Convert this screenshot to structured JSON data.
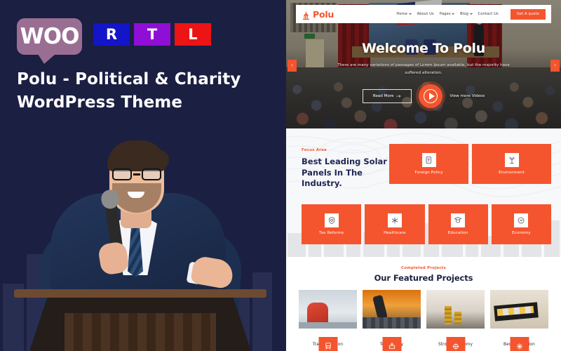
{
  "promo": {
    "badges": {
      "woo": "WOO",
      "rtl": [
        "R",
        "T",
        "L"
      ],
      "woo_color": "#9a6e93",
      "rtl_colors": [
        "#1414c8",
        "#8f0fd6",
        "#ec1414"
      ]
    },
    "title": "Polu - Political & Charity WordPress Theme",
    "background_color": "#1b1f42",
    "figure_alt": "speaker-at-podium"
  },
  "site": {
    "accent_color": "#f4552e",
    "navbar": {
      "logo_icon": "capitol-building-icon",
      "brand": "Polu",
      "links": [
        {
          "label": "Home",
          "has_caret": true
        },
        {
          "label": "About Us",
          "has_caret": false
        },
        {
          "label": "Pages",
          "has_caret": true
        },
        {
          "label": "Blog",
          "has_caret": true
        },
        {
          "label": "Contact Us",
          "has_caret": false
        }
      ],
      "cta": "Get A quote"
    },
    "hero": {
      "title": "Welcome To Polu",
      "subtitle": "There are many variations of passages of Lorem Ipsum available, but the majority have suffered alteration.",
      "primary_button": "Read More",
      "video_label": "View more Videos",
      "prev_arrow": "‹",
      "next_arrow": "›",
      "image_alt": "auditorium-audience-speaker"
    },
    "focus": {
      "eyebrow": "Focus Area",
      "heading": "Best Leading Solar Panels In The Industry.",
      "cards_top": [
        {
          "label": "Foreign Policy",
          "icon": "policy-document-icon"
        },
        {
          "label": "Environment",
          "icon": "plant-environment-icon"
        }
      ],
      "cards_bottom": [
        {
          "label": "Tax Reforms",
          "icon": "shield-tax-icon"
        },
        {
          "label": "Healthcare",
          "icon": "medical-star-icon"
        },
        {
          "label": "Education",
          "icon": "graduation-book-icon"
        },
        {
          "label": "Economy",
          "icon": "economy-growth-icon"
        }
      ]
    },
    "projects": {
      "eyebrow": "Completed Projects",
      "heading": "Our Featured Projects",
      "items": [
        {
          "label": "Transportation",
          "icon": "transport-icon",
          "art": "art-train"
        },
        {
          "label": "Technology",
          "icon": "technology-icon",
          "art": "art-tech"
        },
        {
          "label": "Strong Economy",
          "icon": "economy-icon",
          "art": "art-money"
        },
        {
          "label": "Best Education",
          "icon": "education-icon",
          "art": "art-vol"
        }
      ]
    }
  }
}
